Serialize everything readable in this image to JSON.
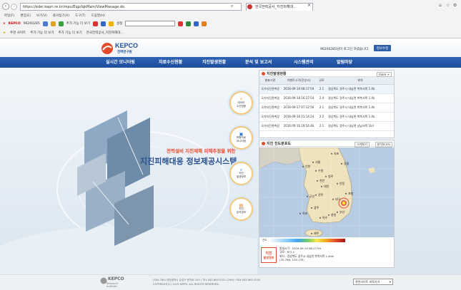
{
  "browser": {
    "url": "https://edei.kepri.re.kr/mpu/Eqp/lqkMain/ViewManage.do",
    "tab_title": "한국전력공사_지진피해대...",
    "menu": [
      "파일(F)",
      "편집(E)",
      "보기(V)",
      "즐겨찾기(A)",
      "도구(T)",
      "도움말(H)"
    ],
    "toolbar_logo": "KEPCO",
    "toolbar_id": "96200285",
    "toolbar_add": "추가 기능 더 보기",
    "toolbar_settings": "설정",
    "favs": [
      "추천 사이트",
      "추가 기능 더 보기",
      "추가 기능 더 보기",
      "한국전력공사_지진피해대..."
    ]
  },
  "header": {
    "logo_main": "KEPCO",
    "logo_sub": "전력연구원",
    "welcome": "96200285님이 로그인 하셨습니다.",
    "logout_label": "정보수정"
  },
  "nav": [
    "실시간 모니터링",
    "자료수신현황",
    "지진발생현황",
    "분석 및 보고서",
    "시스템관리",
    "알림마당"
  ],
  "hero": {
    "subtitle": "전력설비 지진재해 피해추정을 위한",
    "title": "지진피해대응 정보제공시스템"
  },
  "circles": [
    {
      "label1": "데이터",
      "label2": "수신현황"
    },
    {
      "label1": "파형자료",
      "label2": "모니터링"
    },
    {
      "label1": "지진",
      "label2": "발생정보"
    },
    {
      "label1": "지진",
      "label2": "분석정보"
    }
  ],
  "quake_panel": {
    "title": "지진발생현황",
    "more": "more +",
    "headers": [
      "발표기관",
      "이벤트시각(진앙시)",
      "규모",
      "위치"
    ],
    "rows": [
      [
        "국가지진관측망",
        "2016-09-19 08:17:59",
        "2.1",
        "경상북도 경주시 내남면 북북서쪽 1.4k"
      ],
      [
        "국가지진관측망",
        "2016-09-18 16:27:54",
        "2.4",
        "경상북도 경주시 내남면 북북서쪽 1.4k"
      ],
      [
        "국가지진관측망",
        "2016-09-17 07:12:56",
        "2.1",
        "경상북도 경주시 내남면 북북서쪽 1.4k"
      ],
      [
        "국가지진관측망",
        "2016-09-16 21:14:24",
        "2.2",
        "경상북도 경주시 내남면 북북서쪽 1.4k"
      ],
      [
        "국가지진관측망",
        "2016-09-16 19:54:46",
        "2.1",
        "경상북도 경주시 내남면 남남서쪽 1kil"
      ]
    ]
  },
  "map_panel": {
    "title": "지진 진도분포도",
    "btn_zoom": "크게보기",
    "btn_analysis": "분석보고서",
    "cities": [
      "속초",
      "강릉",
      "서울",
      "인천",
      "수원",
      "청주",
      "천안",
      "대전",
      "안동",
      "포항",
      "전주",
      "군산",
      "대구",
      "광주",
      "목포",
      "부산",
      "창원",
      "여수",
      "제주"
    ],
    "legend_title": "진도",
    "info_label1": "지진",
    "info_label2": "발생정보",
    "info_time": "발생시각 : 2016-09-19 08:17:59",
    "info_mag": "규모 : M 2.1",
    "info_loc": "위치 : 경상북도 경주시 내남면 북북서쪽 1.4km",
    "info_coord": "(35.76N, 129.17E)"
  },
  "footer": {
    "logo": "KEPCO",
    "logo_sub": "Research Institute",
    "addr": "(305-760) 대전광역시 유성구 문지로 105  |  TEL 042-865-5321 (24H) / FAX 042-865-5204",
    "copy": "COPYRIGHT(C) 2015 KEPRI. ALL RIGHTS RESERVED.",
    "select": "관련사이트 바로가기"
  },
  "colors": {
    "nav": "#2459a8",
    "accent": "#e34b2c",
    "title_blue": "#2a4f8f",
    "subtitle_red": "#e34b2c"
  }
}
